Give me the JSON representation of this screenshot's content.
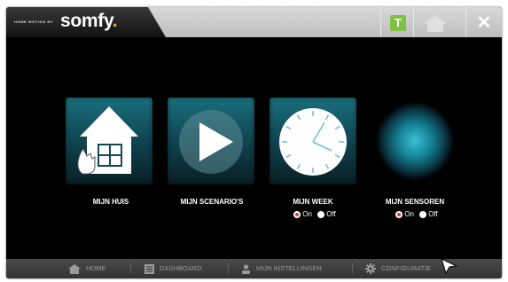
{
  "brand": {
    "tagline": "HOME MOTION BY",
    "logo": "somfy",
    "logo_dot": "."
  },
  "topbar": {
    "t_icon": "T",
    "close": "✕",
    "home_icon": "home-icon"
  },
  "tiles": [
    {
      "label": "MIJN HUIS",
      "icon": "house-icon"
    },
    {
      "label": "MIJN SCENARIO'S",
      "icon": "play-icon"
    },
    {
      "label": "MIJN WEEK",
      "icon": "clock-icon",
      "on": "On",
      "off": "Off",
      "selected": "On"
    },
    {
      "label": "MIJN SENSOREN",
      "icon": "sensor-icon",
      "on": "On",
      "off": "Off",
      "selected": "On"
    }
  ],
  "bottom_nav": [
    {
      "label": "HOME",
      "icon": "home-icon"
    },
    {
      "label": "DASHBOARD",
      "icon": "dashboard-icon"
    },
    {
      "label": "MIJN INSTELLINGEN",
      "icon": "user-icon"
    },
    {
      "label": "CONFIGURATIE",
      "icon": "gear-icon"
    }
  ],
  "colors": {
    "accent": "#1b6f7d",
    "status_green": "#7fc142",
    "radio_on": "#e53333"
  }
}
